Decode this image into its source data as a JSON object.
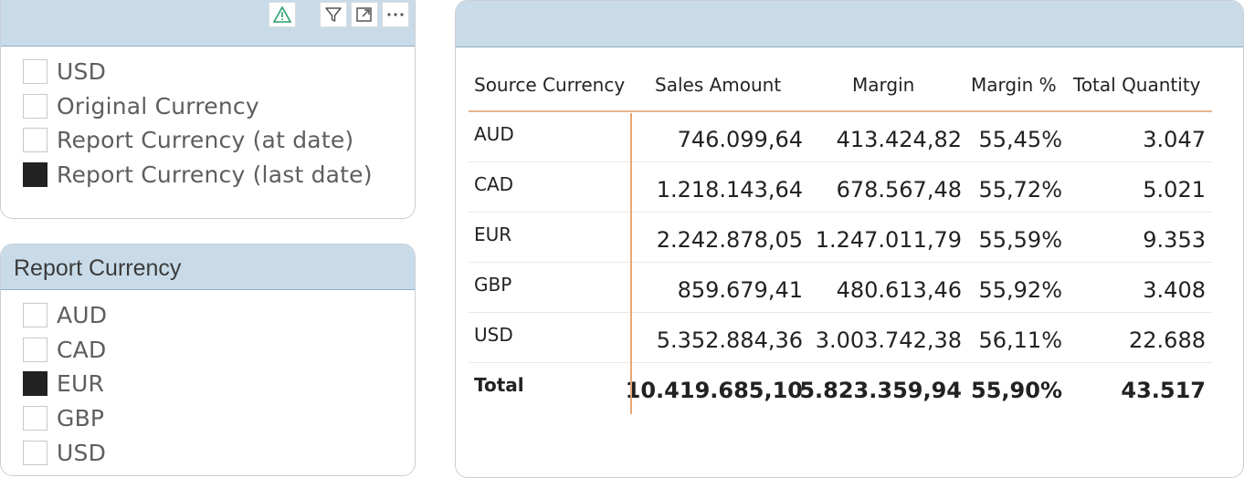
{
  "slicer1": {
    "items": [
      {
        "label": "USD",
        "checked": false
      },
      {
        "label": "Original Currency",
        "checked": false
      },
      {
        "label": "Report Currency (at date)",
        "checked": false
      },
      {
        "label": "Report Currency (last date)",
        "checked": true
      }
    ],
    "toolbar": {
      "warning_icon": "warning-triangle-icon",
      "filter_icon": "filter-icon",
      "focus_icon": "focus-mode-icon",
      "more_icon": "more-options-icon",
      "warning_color": "#2e9e6b"
    }
  },
  "slicer2": {
    "title": "Report Currency",
    "items": [
      {
        "label": "AUD",
        "checked": false
      },
      {
        "label": "CAD",
        "checked": false
      },
      {
        "label": "EUR",
        "checked": true
      },
      {
        "label": "GBP",
        "checked": false
      },
      {
        "label": "USD",
        "checked": false
      }
    ]
  },
  "table": {
    "headers": [
      "Source Currency",
      "Sales Amount",
      "Margin",
      "Margin %",
      "Total Quantity"
    ],
    "rows": [
      [
        "AUD",
        "746.099,64",
        "413.424,82",
        "55,45%",
        "3.047"
      ],
      [
        "CAD",
        "1.218.143,64",
        "678.567,48",
        "55,72%",
        "5.021"
      ],
      [
        "EUR",
        "2.242.878,05",
        "1.247.011,79",
        "55,59%",
        "9.353"
      ],
      [
        "GBP",
        "859.679,41",
        "480.613,46",
        "55,92%",
        "3.408"
      ],
      [
        "USD",
        "5.352.884,36",
        "3.003.742,38",
        "56,11%",
        "22.688"
      ]
    ],
    "total": [
      "Total",
      "10.419.685,10",
      "5.823.359,94",
      "55,90%",
      "43.517"
    ]
  },
  "colors": {
    "header_bg": "#c9dbe8",
    "accent": "#e8a673",
    "checked": "#222222"
  }
}
